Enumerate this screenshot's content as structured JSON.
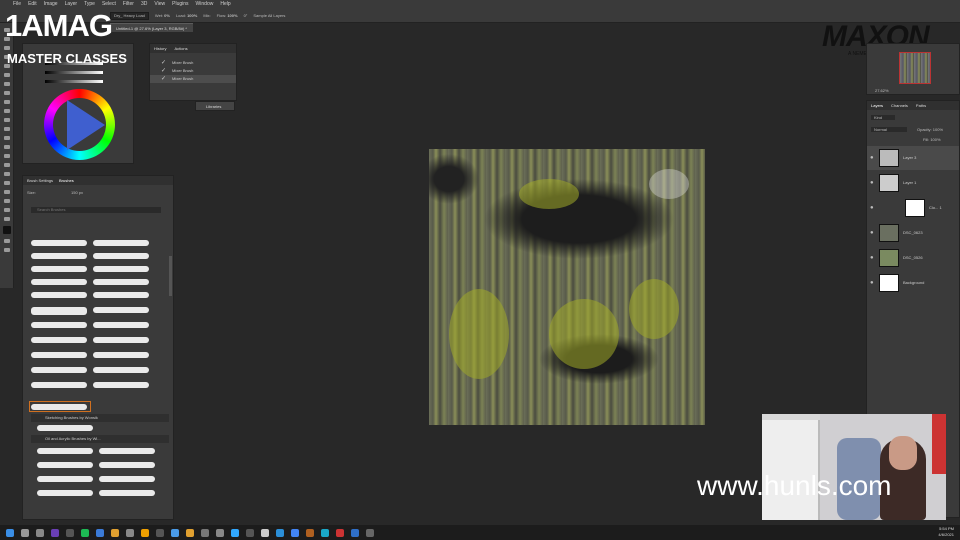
{
  "menubar": {
    "items": [
      "File",
      "Edit",
      "Image",
      "Layer",
      "Type",
      "Select",
      "Filter",
      "3D",
      "View",
      "Plugins",
      "Window",
      "Help"
    ]
  },
  "options": {
    "brush_preset": "Dry_ Heavy Load",
    "wet": "0%",
    "load": "100%",
    "mix": "",
    "flow": "100%",
    "angle": "0°",
    "sample_all": "Sample All Layers"
  },
  "document_tab": "Untitled-1 @ 27.6% (Layer 3, RGB/8#) *",
  "branding": {
    "logo_top": "1AMAG",
    "logo_bottom": "MASTER CLASSES",
    "maxon": "MAXON",
    "maxon_sub": "A NEMETSCHEK COMPANY",
    "website": "www.hunls.com"
  },
  "history": {
    "tabs": [
      "History",
      "Actions"
    ],
    "steps": [
      "Mixer Brush",
      "Mixer Brush",
      "Mixer Brush"
    ]
  },
  "libraries_label": "Libraries",
  "brushes": {
    "tabs": [
      "Brush Settings",
      "Brushes"
    ],
    "size_label": "Size:",
    "size_value": "150 px",
    "search_placeholder": "Search Brushes",
    "folders": [
      "Sketching Brushes by Wonsik",
      "Oil and Acrylic Brushes by Wi..."
    ]
  },
  "navigator": {
    "zoom": "27.62%"
  },
  "layers": {
    "tabs": [
      "Layers",
      "Channels",
      "Paths"
    ],
    "filter": "Kind",
    "blend": "Normal",
    "opacity": "Opacity: 100%",
    "fill": "Fill: 100%",
    "items": [
      "Layer 3",
      "Layer 1",
      "Clo... 1",
      "DSC_0623",
      "DSC_0526",
      "Background"
    ]
  },
  "clock": {
    "time": "5:54 PM",
    "date": "4/6/2021"
  },
  "colors": {
    "accent": "#3a3a3a",
    "canvas_bg": "#282828"
  }
}
